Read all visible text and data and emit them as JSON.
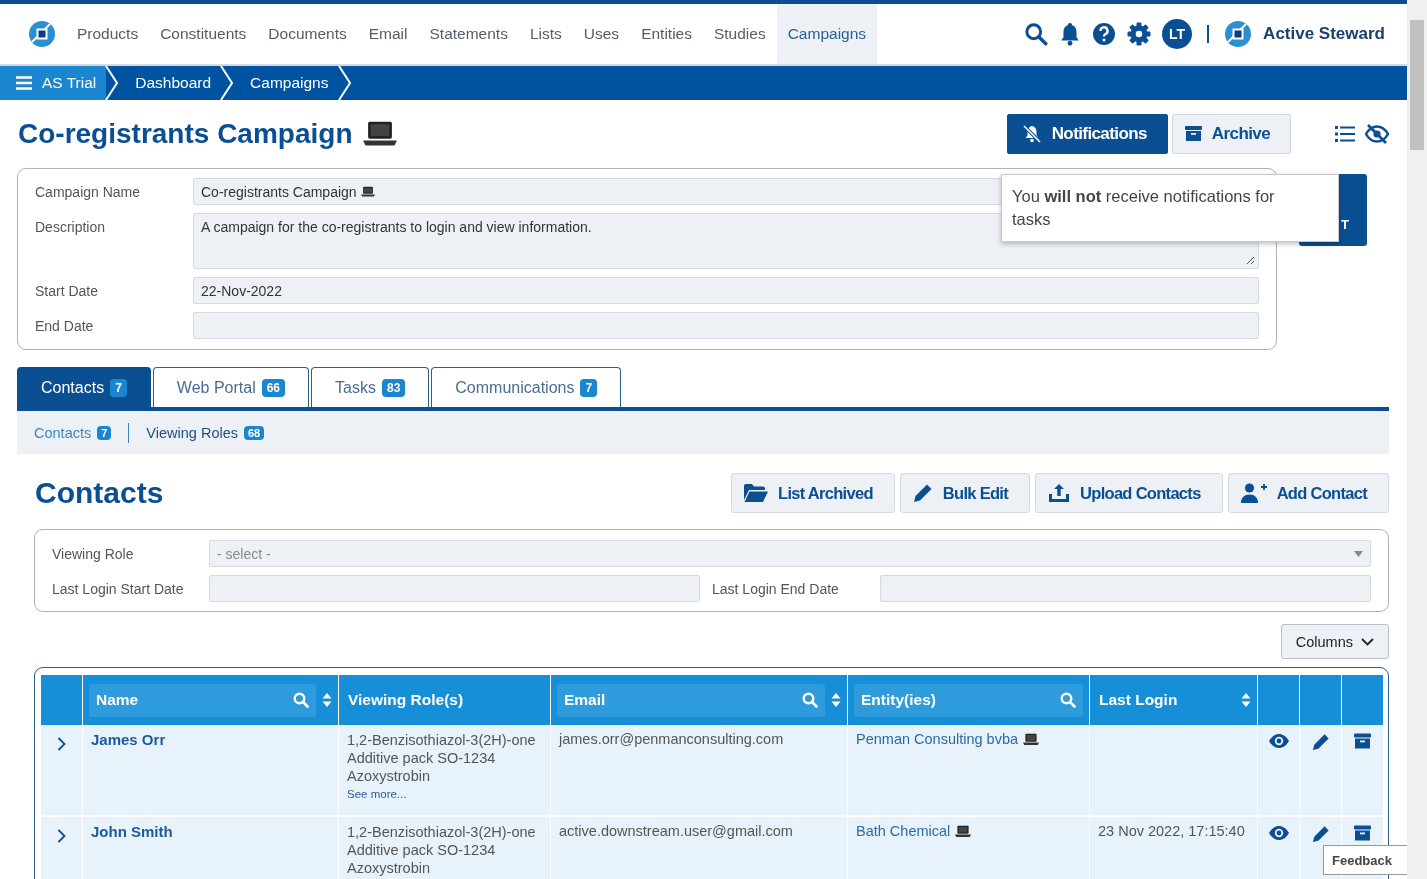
{
  "nav": {
    "items": [
      {
        "label": "Products",
        "selected": false
      },
      {
        "label": "Constituents",
        "selected": false
      },
      {
        "label": "Documents",
        "selected": false
      },
      {
        "label": "Email",
        "selected": false
      },
      {
        "label": "Statements",
        "selected": false
      },
      {
        "label": "Lists",
        "selected": false
      },
      {
        "label": "Uses",
        "selected": false
      },
      {
        "label": "Entities",
        "selected": false
      },
      {
        "label": "Studies",
        "selected": false
      },
      {
        "label": "Campaigns",
        "selected": true
      }
    ],
    "avatar": "LT",
    "brand": "Active Steward"
  },
  "breadcrumb": [
    "AS Trial",
    "Dashboard",
    "Campaigns"
  ],
  "page": {
    "title": "Co-registrants Campaign",
    "device": true
  },
  "header_buttons": [
    {
      "label": "Notifications",
      "kind": "notifications",
      "primary": true
    },
    {
      "label": "Archive",
      "kind": "archive",
      "primary": false
    }
  ],
  "form": {
    "fields": [
      {
        "label": "Campaign Name",
        "kind": "input",
        "value": "Co-registrants Campaign",
        "device": true
      },
      {
        "label": "Description",
        "kind": "textarea",
        "value": "A campaign for the co-registrants to login and view information.",
        "device": false
      },
      {
        "label": "Start Date",
        "kind": "input",
        "value": "22-Nov-2022",
        "device": false
      },
      {
        "label": "End Date",
        "kind": "input",
        "device": false
      }
    ]
  },
  "side_button": {
    "label": "T"
  },
  "tooltip": "You **will not** receive notifications for tasks",
  "tabs": [
    {
      "label": "Contacts",
      "count": "7",
      "selected": true
    },
    {
      "label": "Web Portal",
      "count": "66",
      "selected": false
    },
    {
      "label": "Tasks",
      "count": "83",
      "selected": false
    },
    {
      "label": "Communications",
      "count": "7",
      "selected": false
    }
  ],
  "subtabs": [
    {
      "label": "Contacts",
      "count": "7",
      "selected": true
    },
    {
      "label": "Viewing Roles",
      "count": "68",
      "selected": false
    }
  ],
  "section": {
    "title": "Contacts",
    "buttons": [
      {
        "label": "List Archived",
        "kind": "folder"
      },
      {
        "label": "Bulk Edit",
        "kind": "pencil"
      },
      {
        "label": "Upload Contacts",
        "kind": "upload"
      },
      {
        "label": "Add Contact",
        "kind": "add-user"
      }
    ]
  },
  "filters": {
    "viewing_role": {
      "label": "Viewing Role",
      "placeholder": "- select -"
    },
    "start": {
      "label": "Last Login Start Date"
    },
    "end": {
      "label": "Last Login End Date"
    }
  },
  "columns_button": "Columns",
  "table": {
    "columns": [
      {
        "label": "Name",
        "search": true,
        "sort": true
      },
      {
        "label": "Viewing Role(s)",
        "search": false,
        "sort": false
      },
      {
        "label": "Email",
        "search": true,
        "sort": true
      },
      {
        "label": "Entity(ies)",
        "search": true,
        "sort": false
      },
      {
        "label": "Last Login",
        "search": false,
        "sort": true
      }
    ],
    "rows": [
      {
        "name": "James Orr",
        "roles": [
          "1,2-Benzisothiazol-3(2H)-one",
          "Additive pack SO-1234",
          "Azoxystrobin"
        ],
        "see_more": "See more...",
        "email": "james.orr@penmanconsulting.com",
        "entity": "Penman Consulting bvba",
        "device": true
      },
      {
        "name": "John Smith",
        "roles": [
          "1,2-Benzisothiazol-3(2H)-one",
          "Additive pack SO-1234",
          "Azoxystrobin"
        ],
        "email": "active.downstream.user@gmail.com",
        "entity": "Bath Chemical",
        "device": true,
        "last_login": "23 Nov 2022, 17:15:40"
      }
    ]
  },
  "feedback": "Feedback"
}
